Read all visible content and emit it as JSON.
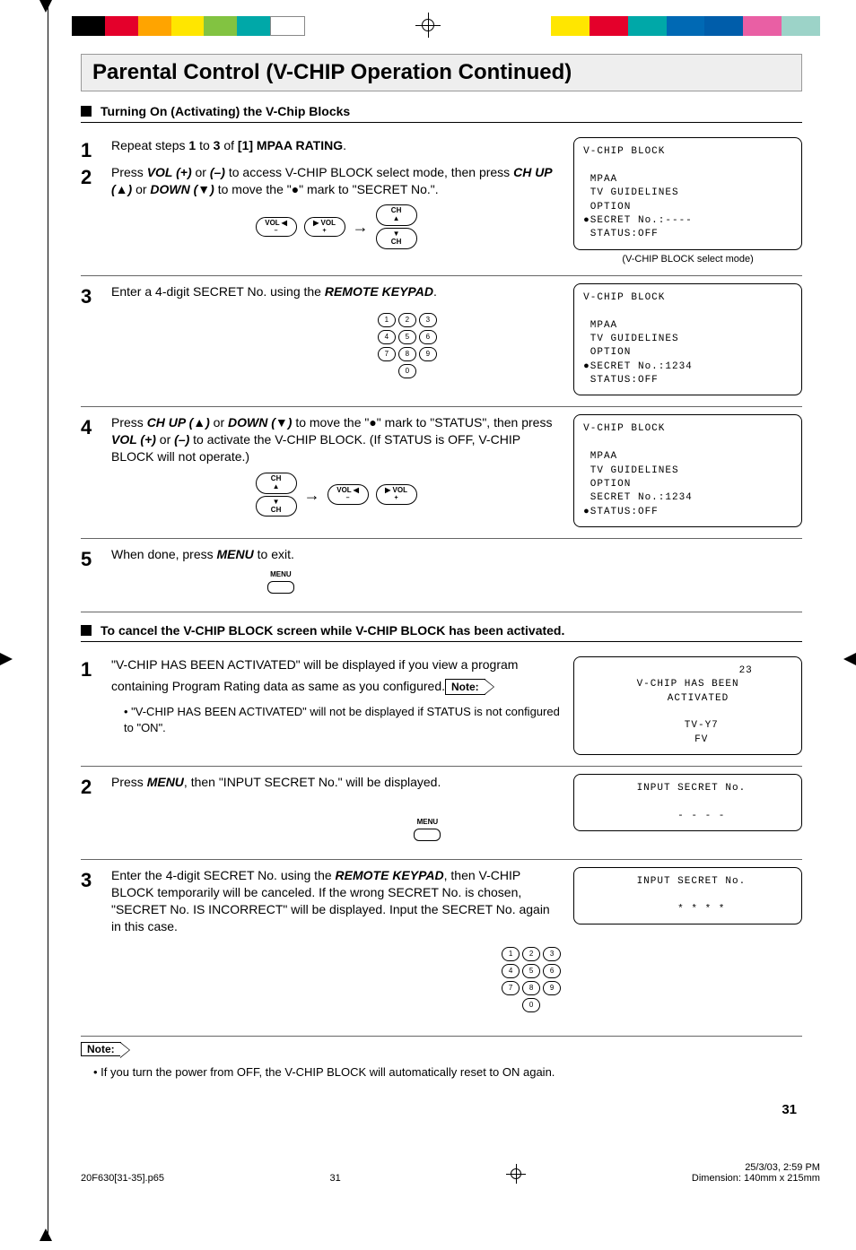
{
  "color_strips": {
    "left": [
      "#000000",
      "#E4002B",
      "#FFA400",
      "#FFE600",
      "#82C341",
      "#00A8A8",
      "#FFFFFF"
    ],
    "right": [
      "#FFE600",
      "#E4002B",
      "#00A8A8",
      "#0069B4",
      "#005DAA",
      "#E95FA4",
      "#9CD3C8"
    ]
  },
  "title": "Parental Control (V-CHIP Operation Continued)",
  "section_a": "Turning On (Activating) the V-Chip Blocks",
  "steps_a": [
    {
      "num": "1",
      "body": "Repeat steps <b>1</b> to <b>3</b> of <b>[1] MPAA RATING</b>.",
      "merge_next": true
    },
    {
      "num": "2",
      "body": "Press <span class='ital'>VOL (+)</span> or <span class='ital'>(–)</span> to access V-CHIP BLOCK select mode, then press <span class='ital'>CH UP (▲)</span> or <span class='ital'>DOWN (▼)</span> to move the \"●\" mark to \"SECRET No.\".",
      "controls": "vols_ch",
      "osd": "V-CHIP BLOCK\n\n MPAA\n TV GUIDELINES\n OPTION\n●SECRET No.:----\n STATUS:OFF",
      "caption": "(V-CHIP BLOCK select mode)"
    },
    {
      "num": "3",
      "body": "Enter a 4-digit SECRET No. using the <span class='ital'>REMOTE KEYPAD</span>.",
      "controls": "keypad",
      "osd": "V-CHIP BLOCK\n\n MPAA\n TV GUIDELINES\n OPTION\n●SECRET No.:1234\n STATUS:OFF"
    },
    {
      "num": "4",
      "body": "Press <span class='ital'>CH UP (▲)</span> or <span class='ital'>DOWN (▼)</span> to move the \"●\" mark to \"STATUS\", then press <span class='ital'>VOL (+)</span> or <span class='ital'>(–)</span> to activate the V-CHIP BLOCK. (If STATUS is OFF, V-CHIP BLOCK will not operate.)",
      "controls": "ch_vols",
      "osd": "V-CHIP BLOCK\n\n MPAA\n TV GUIDELINES\n OPTION\n SECRET No.:1234\n●STATUS:OFF"
    },
    {
      "num": "5",
      "body": "When done, press <span class='ital'>MENU</span> to exit.",
      "controls": "menu",
      "no_osd": true
    }
  ],
  "section_b": "To cancel the V-CHIP BLOCK screen while V-CHIP BLOCK has been activated.",
  "steps_b": [
    {
      "num": "1",
      "body": "\"V-CHIP HAS BEEN ACTIVATED\" will be displayed if you view a program containing Program Rating data as same as you configured.",
      "note": "Note:",
      "note_body": "\"V-CHIP HAS BEEN ACTIVATED\" will not be displayed if STATUS is not configured to \"ON\".",
      "osd": "                 23\nV-CHIP HAS BEEN\n   ACTIVATED\n\n    TV-Y7\n    FV",
      "osd_center": true
    },
    {
      "num": "2",
      "body": "Press <span class='ital'>MENU</span>, then \"INPUT SECRET No.\" will be displayed.",
      "controls": "menu_below",
      "osd": " INPUT SECRET No.\n\n    - - - -",
      "osd_center": true
    },
    {
      "num": "3",
      "body": "Enter the 4-digit SECRET No. using the <span class='ital'>REMOTE KEYPAD</span>, then V-CHIP BLOCK temporarily will be canceled. If the wrong SECRET No. is chosen, \"SECRET No. IS INCORRECT\" will be displayed. Input the SECRET No. again in this case.",
      "controls": "keypad",
      "osd": " INPUT SECRET No.\n\n    * * * *",
      "osd_center": true
    }
  ],
  "final_note_label": "Note:",
  "final_note": "If you turn the power from OFF, the V-CHIP BLOCK will automatically reset to ON again.",
  "page_number": "31",
  "footer": {
    "file": "20F630[31-35].p65",
    "page": "31",
    "datetime": "25/3/03, 2:59 PM",
    "dimension": "Dimension: 140mm x 215mm"
  },
  "labels": {
    "vol_minus": "VOL\n–",
    "vol_plus": "VOL\n+",
    "ch_up": "CH\n▲",
    "ch_down": "▼\nCH",
    "menu": "MENU",
    "vol_left_tri": "◀",
    "vol_right_tri": "▶"
  }
}
